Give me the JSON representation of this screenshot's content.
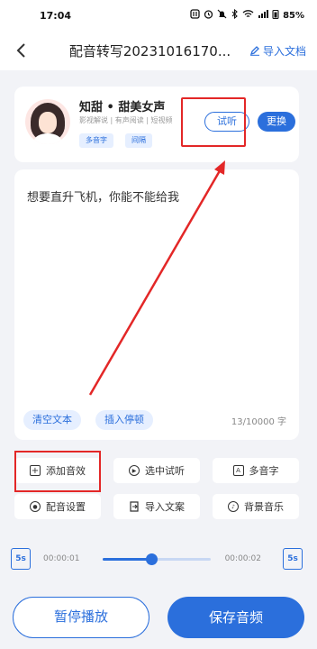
{
  "status_bar": {
    "time": "17:04",
    "icons": [
      "nfc-icon",
      "alarm-icon",
      "mute-icon",
      "bluetooth-icon",
      "wifi-icon",
      "signal-icon",
      "battery-icon"
    ],
    "battery": "85%"
  },
  "header": {
    "title": "配音转写20231016170...",
    "import_label": "导入文档"
  },
  "voice_card": {
    "name": "知甜 • 甜美女声",
    "tags": "影视解说 | 有声阅读 | 短视频",
    "chips": [
      "多音字",
      "间隔"
    ],
    "preview_label": "试听",
    "change_label": "更换"
  },
  "editor": {
    "text": "想要直升飞机，你能不能给我",
    "clear_label": "清空文本",
    "insert_pause_label": "插入停顿",
    "char_count": "13/10000 字"
  },
  "functions": [
    {
      "label": "添加音效",
      "icon": "plus-box-icon"
    },
    {
      "label": "选中试听",
      "icon": "play-circle-icon"
    },
    {
      "label": "多音字",
      "icon": "text-box-icon"
    },
    {
      "label": "配音设置",
      "icon": "settings-circle-icon"
    },
    {
      "label": "导入文案",
      "icon": "import-icon"
    },
    {
      "label": "背景音乐",
      "icon": "music-icon"
    }
  ],
  "player": {
    "back_label": "5s",
    "forward_label": "5s",
    "current_time": "00:00:01",
    "end_time": "00:00:02",
    "progress": 0.45
  },
  "bottom": {
    "pause_label": "暂停播放",
    "save_label": "保存音频"
  },
  "colors": {
    "accent": "#2b6fdc",
    "annotation": "#e32727"
  }
}
